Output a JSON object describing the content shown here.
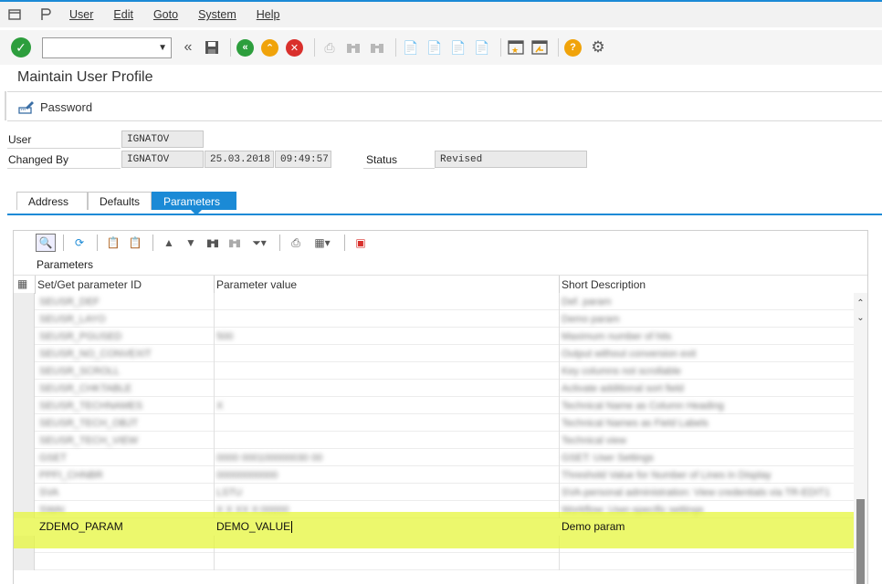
{
  "menubar": {
    "items": [
      "User",
      "Edit",
      "Goto",
      "System",
      "Help"
    ]
  },
  "toolbar": {
    "icons": [
      "enter-icon",
      "back-icon",
      "save-icon",
      "exit-icon",
      "up-icon",
      "cancel-icon",
      "print-icon",
      "find-icon",
      "find-next-icon",
      "first-page-icon",
      "previous-page-icon",
      "next-page-icon",
      "last-page-icon",
      "new-session-icon",
      "shortcut-icon",
      "help-icon",
      "settings-icon"
    ]
  },
  "page": {
    "title": "Maintain User Profile"
  },
  "app_toolbar": {
    "password_label": "Password"
  },
  "header": {
    "user_label": "User",
    "user_value": "IGNATOV",
    "changed_by_label": "Changed By",
    "changed_by_value": "IGNATOV",
    "changed_date": "25.03.2018",
    "changed_time": "09:49:57",
    "status_label": "Status",
    "status_value": "Revised"
  },
  "tabs": [
    {
      "label": "Address",
      "active": false
    },
    {
      "label": "Defaults",
      "active": false
    },
    {
      "label": "Parameters",
      "active": true
    }
  ],
  "grid": {
    "title": "Parameters",
    "columns": [
      "Set/Get parameter ID",
      "Parameter value",
      "Short Description"
    ],
    "blurred_rows": [
      {
        "id": "SEUSR_DEF",
        "value": "",
        "desc": "Def. param"
      },
      {
        "id": "SEUSR_LAYO",
        "value": "",
        "desc": "Demo param"
      },
      {
        "id": "SEUSR_PGUSED",
        "value": "500",
        "desc": "Maximum number of hits"
      },
      {
        "id": "SEUSR_NO_CONVEXIT",
        "value": "",
        "desc": "Output without conversion exit"
      },
      {
        "id": "SEUSR_SCROLL",
        "value": "",
        "desc": "Key columns not scrollable"
      },
      {
        "id": "SEUSR_CHKTABLE",
        "value": "",
        "desc": "Activate additional sort field"
      },
      {
        "id": "SEUSR_TECHNAMES",
        "value": "X",
        "desc": "Technical Name as Column Heading"
      },
      {
        "id": "SEUSR_TECH_OBJT",
        "value": "",
        "desc": "Technical Names as Field Labels"
      },
      {
        "id": "SEUSR_TECH_VIEW",
        "value": "",
        "desc": "Technical view"
      },
      {
        "id": "GSET",
        "value": "0000   000100000030 00",
        "desc": "GSET: User Settings"
      },
      {
        "id": "PPFI_CHNBR",
        "value": "00000000000",
        "desc": "Threshold Value for Number of Lines in Display"
      },
      {
        "id": "SVA",
        "value": "LSTU",
        "desc": "SVA-personal administration: View credentials via TR-EDIT1"
      },
      {
        "id": "SWAI",
        "value": "X  X  XX  X:00000",
        "desc": "Workflow: User-specific settings"
      }
    ],
    "highlighted_row": {
      "id": "ZDEMO_PARAM",
      "value": "DEMO_VALUE",
      "desc": "Demo param"
    }
  },
  "colors": {
    "accent": "#1b8ad6",
    "highlight": "#e6f53c",
    "ok_green": "#2d9e3d",
    "nav_green": "#2d9e3d",
    "nav_orange": "#f0a30a",
    "cancel_red": "#d9302c",
    "help_yellow": "#f0a30a"
  }
}
